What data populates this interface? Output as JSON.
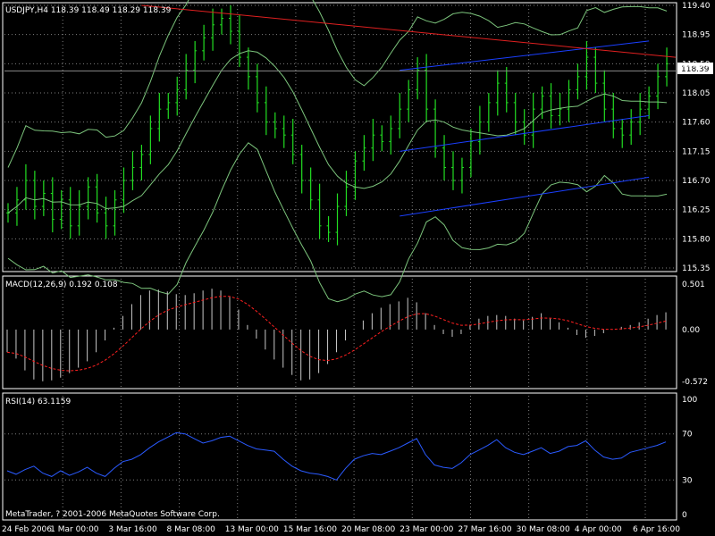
{
  "chart_data": [
    {
      "type": "ohlc",
      "title": "USDJPY,H4  118.39 118.49 118.29 118.39",
      "symbol": "USDJPY",
      "timeframe": "H4",
      "last_bar": {
        "open": 118.39,
        "high": 118.49,
        "low": 118.29,
        "close": 118.39
      },
      "current_price_label": "118.39",
      "current_price": 118.39,
      "price_axis_ticks": [
        "119.40",
        "118.95",
        "118.50",
        "118.05",
        "117.60",
        "117.15",
        "116.70",
        "116.25",
        "115.80",
        "115.35"
      ],
      "ylim": [
        115.35,
        119.4
      ],
      "close_series": [
        116.2,
        116.4,
        116.7,
        116.3,
        116.5,
        116.1,
        116.4,
        116.0,
        116.3,
        116.6,
        116.2,
        116.0,
        116.4,
        116.7,
        116.9,
        117.1,
        117.5,
        117.8,
        117.9,
        118.1,
        118.4,
        118.7,
        118.9,
        119.1,
        119.2,
        119.0,
        118.6,
        118.3,
        117.9,
        117.6,
        117.5,
        117.4,
        117.1,
        116.7,
        116.4,
        116.0,
        115.9,
        116.3,
        116.6,
        117.0,
        117.2,
        117.4,
        117.3,
        117.5,
        117.8,
        118.1,
        118.4,
        117.8,
        117.2,
        116.9,
        116.7,
        116.9,
        117.3,
        117.6,
        117.9,
        118.2,
        117.9,
        117.6,
        117.4,
        117.8,
        118.0,
        117.7,
        117.8,
        118.1,
        118.3,
        118.6,
        118.2,
        117.8,
        117.5,
        117.4,
        117.6,
        117.8,
        118.0,
        118.3,
        118.5
      ],
      "overlays": [
        {
          "name": "bollinger-bands",
          "color": "#7cc47c"
        },
        {
          "name": "trend-channel",
          "color": "#1a3fff"
        },
        {
          "name": "resistance-line",
          "color": "#e02020"
        }
      ],
      "colors": {
        "bars": "#22dd22",
        "axis": "#ffffff",
        "grid": "#7f7f7f"
      }
    },
    {
      "type": "histogram",
      "title": "MACD(12,26,9) 0.192 0.108",
      "axis_ticks": [
        "0.501",
        "0.00",
        "-0.572"
      ],
      "ylim": [
        -0.572,
        0.501
      ],
      "values": [
        -0.25,
        -0.32,
        -0.45,
        -0.55,
        -0.57,
        -0.56,
        -0.53,
        -0.48,
        -0.42,
        -0.35,
        -0.25,
        -0.12,
        0.02,
        0.15,
        0.28,
        0.38,
        0.43,
        0.44,
        0.42,
        0.39,
        0.38,
        0.4,
        0.43,
        0.45,
        0.43,
        0.36,
        0.22,
        0.05,
        -0.1,
        -0.22,
        -0.33,
        -0.42,
        -0.5,
        -0.56,
        -0.55,
        -0.48,
        -0.38,
        -0.25,
        -0.12,
        0.0,
        0.1,
        0.18,
        0.24,
        0.28,
        0.31,
        0.35,
        0.3,
        0.18,
        0.05,
        -0.05,
        -0.08,
        -0.05,
        0.05,
        0.12,
        0.15,
        0.16,
        0.15,
        0.12,
        0.1,
        0.14,
        0.18,
        0.12,
        0.08,
        0.02,
        -0.06,
        -0.09,
        -0.07,
        -0.04,
        0.0,
        0.03,
        0.05,
        0.08,
        0.12,
        0.16,
        0.19
      ],
      "signal_line_color": "#ff2020",
      "color": "#c8c8c8"
    },
    {
      "type": "line",
      "title": "RSI(14) 63.1159",
      "axis_ticks": [
        "100",
        "70",
        "30",
        "0"
      ],
      "ylim": [
        0,
        100
      ],
      "values": [
        38,
        35,
        39,
        42,
        36,
        33,
        38,
        34,
        37,
        41,
        36,
        33,
        40,
        46,
        48,
        52,
        58,
        63,
        67,
        71,
        70,
        66,
        62,
        64,
        67,
        68,
        64,
        60,
        57,
        56,
        55,
        48,
        42,
        38,
        36,
        35,
        33,
        30,
        40,
        48,
        51,
        53,
        52,
        55,
        58,
        62,
        66,
        52,
        43,
        41,
        40,
        45,
        52,
        56,
        60,
        65,
        58,
        54,
        52,
        55,
        58,
        53,
        55,
        59,
        60,
        64,
        56,
        50,
        48,
        49,
        54,
        56,
        58,
        60,
        63
      ],
      "color": "#2a5aff"
    }
  ],
  "x_axis_labels": [
    "24 Feb 2006",
    "1 Mar 00:00",
    "3 Mar 16:00",
    "8 Mar 08:00",
    "13 Mar 00:00",
    "15 Mar 16:00",
    "20 Mar 08:00",
    "23 Mar 00:00",
    "27 Mar 16:00",
    "30 Mar 08:00",
    "4 Apr 00:00",
    "6 Apr 16:00"
  ],
  "copyright": "MetaTrader, ? 2001-2006 MetaQuotes Software Corp."
}
